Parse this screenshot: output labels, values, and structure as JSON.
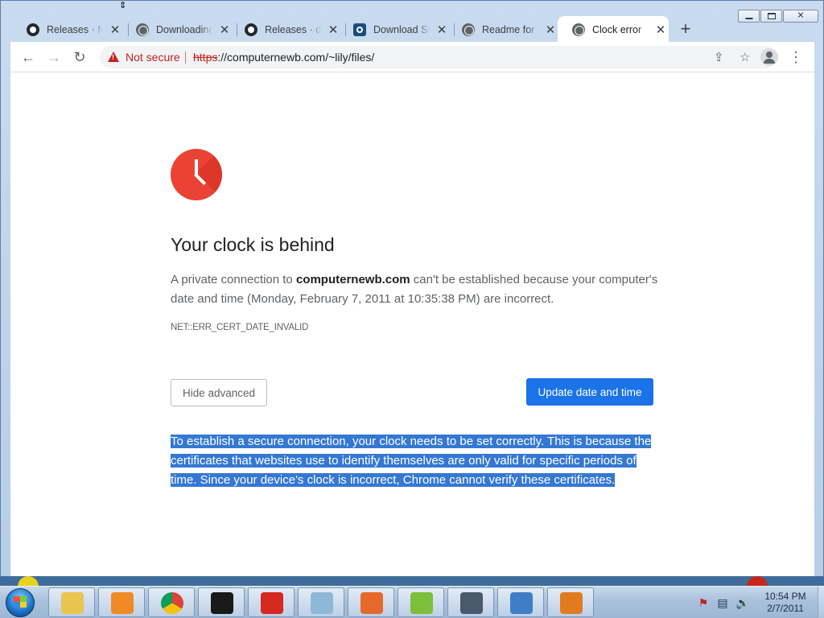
{
  "window": {
    "caption_buttons": {
      "minimize": "minimize",
      "maximize": "maximize",
      "close": "close"
    }
  },
  "tabs": [
    {
      "title": "Releases · Na",
      "icon": "github-icon",
      "active": false
    },
    {
      "title": "Downloading",
      "icon": "globe-icon",
      "active": false
    },
    {
      "title": "Releases · dn",
      "icon": "github-icon",
      "active": false
    },
    {
      "title": "Download St",
      "icon": "download-site-icon",
      "active": false
    },
    {
      "title": "Readme for",
      "icon": "globe-icon",
      "active": false
    },
    {
      "title": "Clock error",
      "icon": "globe-icon",
      "active": true
    }
  ],
  "toolbar": {
    "not_secure": "Not secure",
    "url_scheme": "https",
    "url_rest": "://computernewb.com/~lily/files/"
  },
  "page": {
    "heading": "Your clock is behind",
    "desc_part1": "A private connection to ",
    "desc_host": "computernewb.com",
    "desc_part2": " can't be established because your computer's date and time (Monday, February 7, 2011 at 10:35:38 PM) are incorrect.",
    "error_code": "NET::ERR_CERT_DATE_INVALID",
    "hide_advanced": "Hide advanced",
    "update_button": "Update date and time",
    "details": "To establish a secure connection, your clock needs to be set correctly. This is because the certificates that websites use to identify themselves are only valid for specific periods of time. Since your device's clock is incorrect, Chrome cannot verify these certificates."
  },
  "taskbar": {
    "apps": [
      {
        "name": "explorer-icon",
        "color": "#e9c44f"
      },
      {
        "name": "media-player-icon",
        "color": "#f08a24"
      },
      {
        "name": "chrome-icon",
        "color": "#4285f4"
      },
      {
        "name": "7zip-icon",
        "color": "#1a1a1a"
      },
      {
        "name": "red-app-icon",
        "color": "#d42a1f"
      },
      {
        "name": "notepad-icon",
        "color": "#8fb8d8"
      },
      {
        "name": "paint-app-icon",
        "color": "#e56a2a"
      },
      {
        "name": "notepad-plus-icon",
        "color": "#7cbf3a"
      },
      {
        "name": "window-switcher-icon",
        "color": "#4a5a6c"
      },
      {
        "name": "network-tool-icon",
        "color": "#3f7ec6"
      },
      {
        "name": "java-icon",
        "color": "#e07b1f"
      }
    ],
    "time": "10:54 PM",
    "date": "2/7/2011"
  },
  "colors": {
    "accent": "#1a73e8",
    "error": "#c5221f",
    "clock_icon": "#ea4335",
    "selection": "#3478d4"
  }
}
